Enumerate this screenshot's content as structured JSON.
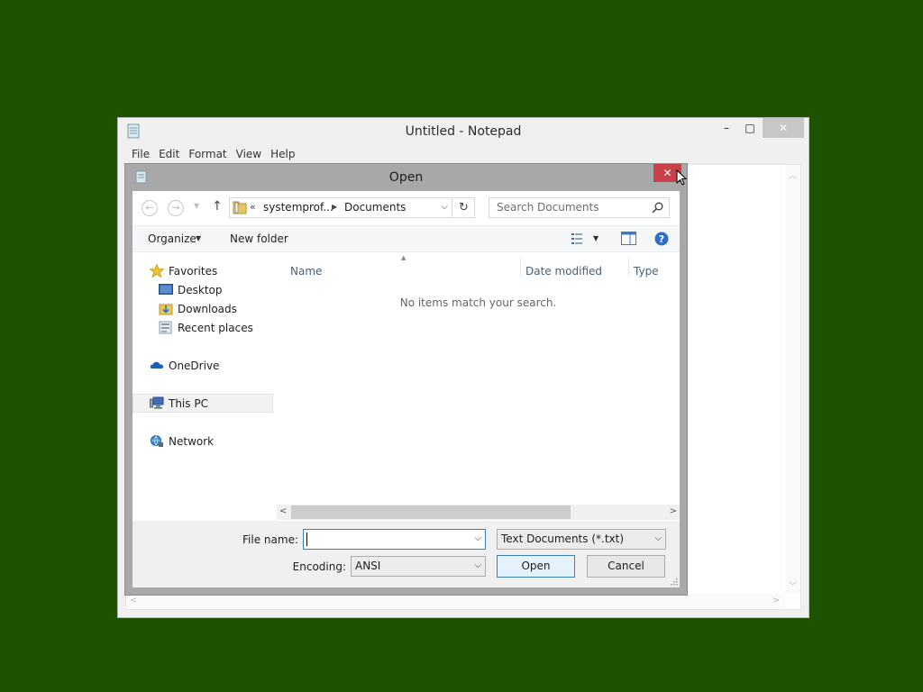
{
  "notepad": {
    "title": "Untitled - Notepad",
    "menu": [
      "File",
      "Edit",
      "Format",
      "View",
      "Help"
    ],
    "window_buttons": {
      "minimize": "–",
      "maximize": "□",
      "close": "✕"
    }
  },
  "dialog": {
    "title": "Open",
    "close": "✕",
    "address": {
      "overflow": "«",
      "crumbs": [
        "systemprof...",
        "Documents"
      ]
    },
    "search": {
      "placeholder": "Search Documents"
    },
    "toolbar": {
      "organize": "Organize",
      "new_folder": "New folder"
    },
    "nav": [
      {
        "label": "Favorites",
        "icon": "star-icon"
      },
      {
        "label": "Desktop",
        "icon": "desktop-icon"
      },
      {
        "label": "Downloads",
        "icon": "downloads-folder-icon"
      },
      {
        "label": "Recent places",
        "icon": "recent-places-icon"
      },
      {
        "label": "OneDrive",
        "icon": "onedrive-icon"
      },
      {
        "label": "This PC",
        "icon": "this-pc-icon",
        "selected": true
      },
      {
        "label": "Network",
        "icon": "network-icon"
      }
    ],
    "columns": [
      "Name",
      "Date modified",
      "Type"
    ],
    "empty_message": "No items match your search.",
    "file_name_label": "File name:",
    "file_name_value": "",
    "file_type": "Text Documents (*.txt)",
    "encoding_label": "Encoding:",
    "encoding_value": "ANSI",
    "open_button": "Open",
    "cancel_button": "Cancel"
  },
  "colors": {
    "desktop": "#1f5200",
    "dialog_frame": "#a8a8a8",
    "close_red": "#c7404a",
    "column_header": "#4c607a"
  }
}
